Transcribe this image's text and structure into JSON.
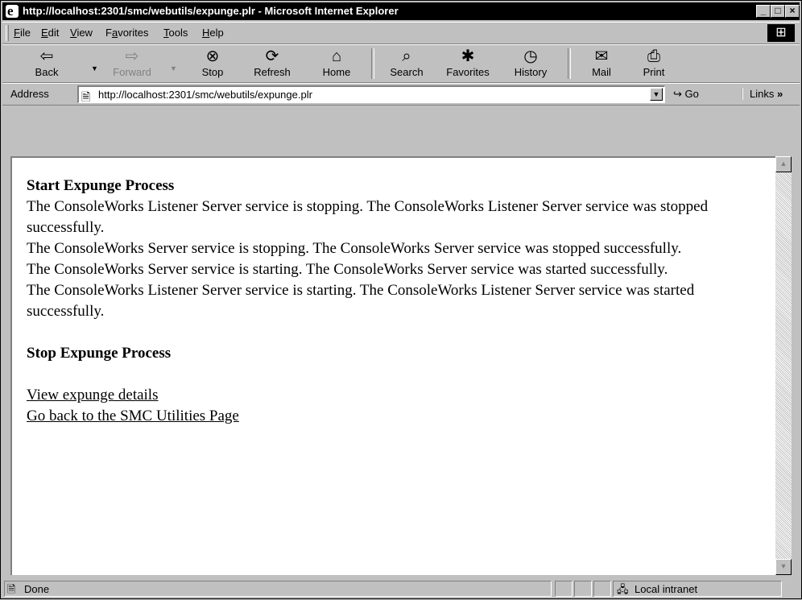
{
  "window": {
    "title": "http://localhost:2301/smc/webutils/expunge.plr - Microsoft Internet Explorer",
    "minimize": "_",
    "maximize": "□",
    "close": "×"
  },
  "menu": [
    "File",
    "Edit",
    "View",
    "Favorites",
    "Tools",
    "Help"
  ],
  "menu_mnemonic": [
    "F",
    "E",
    "V",
    "a",
    "T",
    "H"
  ],
  "toolbar": {
    "back": "Back",
    "forward": "Forward",
    "stop": "Stop",
    "refresh": "Refresh",
    "home": "Home",
    "search": "Search",
    "favorites": "Favorites",
    "history": "History",
    "mail": "Mail",
    "print": "Print"
  },
  "address": {
    "label": "Address",
    "url": "http://localhost:2301/smc/webutils/expunge.plr",
    "go": "Go",
    "links": "Links"
  },
  "page": {
    "start_heading": "Start Expunge Process",
    "lines": [
      "The ConsoleWorks Listener Server service is stopping. The ConsoleWorks Listener Server service was stopped successfully.",
      "The ConsoleWorks Server service is stopping. The ConsoleWorks Server service was stopped successfully.",
      "The ConsoleWorks Server service is starting. The ConsoleWorks Server service was started successfully.",
      "The ConsoleWorks Listener Server service is starting. The ConsoleWorks Listener Server service was started successfully."
    ],
    "stop_heading": "Stop Expunge Process",
    "link_details": "View expunge details",
    "link_back": "Go back to the SMC Utilities Page"
  },
  "status": {
    "text": "Done",
    "zone": "Local intranet"
  }
}
